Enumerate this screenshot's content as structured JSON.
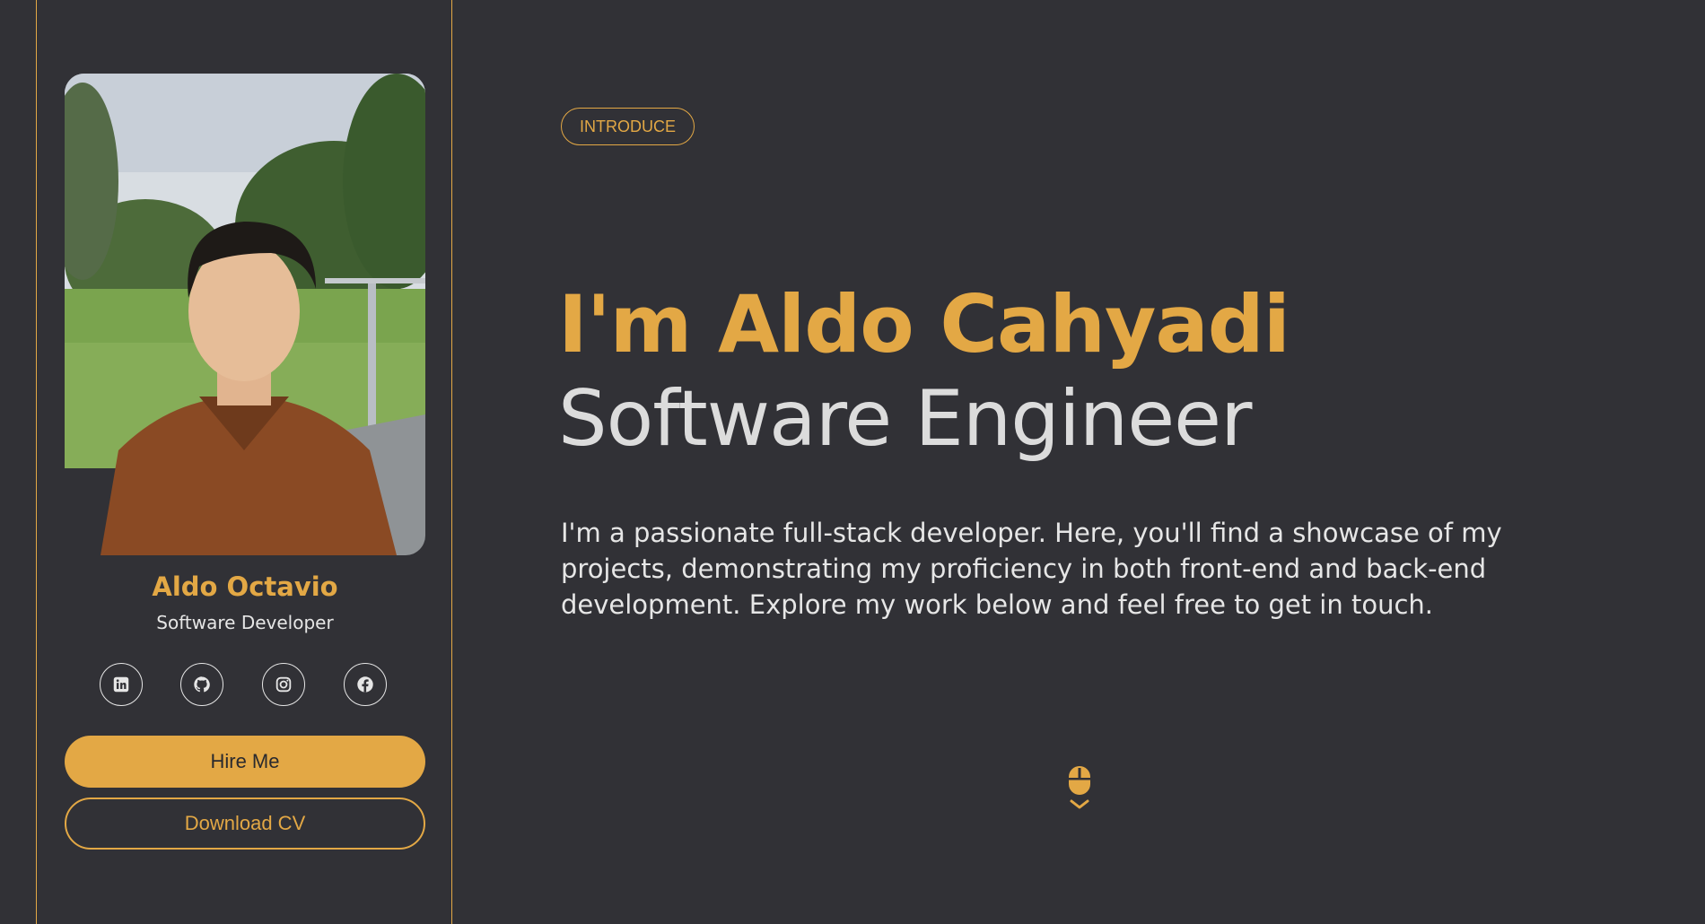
{
  "profile": {
    "photo_alt": "Portrait photo",
    "name": "Aldo Octavio",
    "role": "Software Developer",
    "socials": [
      {
        "name": "linkedin",
        "icon": "linkedin-icon"
      },
      {
        "name": "github",
        "icon": "github-icon"
      },
      {
        "name": "instagram",
        "icon": "instagram-icon"
      },
      {
        "name": "facebook",
        "icon": "facebook-icon"
      }
    ],
    "hire_label": "Hire Me",
    "cv_label": "Download CV"
  },
  "hero": {
    "badge": "INTRODUCE",
    "name_line": "I'm Aldo Cahyadi",
    "title_line": "Software Engineer",
    "description": "I'm a passionate full-stack developer. Here, you'll find a showcase of my projects, demonstrating my proficiency in both front-end and back-end development. Explore my work below and feel free to get in touch."
  },
  "scroll": {
    "icon": "mouse-scroll-icon"
  },
  "colors": {
    "background": "#313136",
    "accent": "#e3a845",
    "text": "#e6e6e6"
  }
}
